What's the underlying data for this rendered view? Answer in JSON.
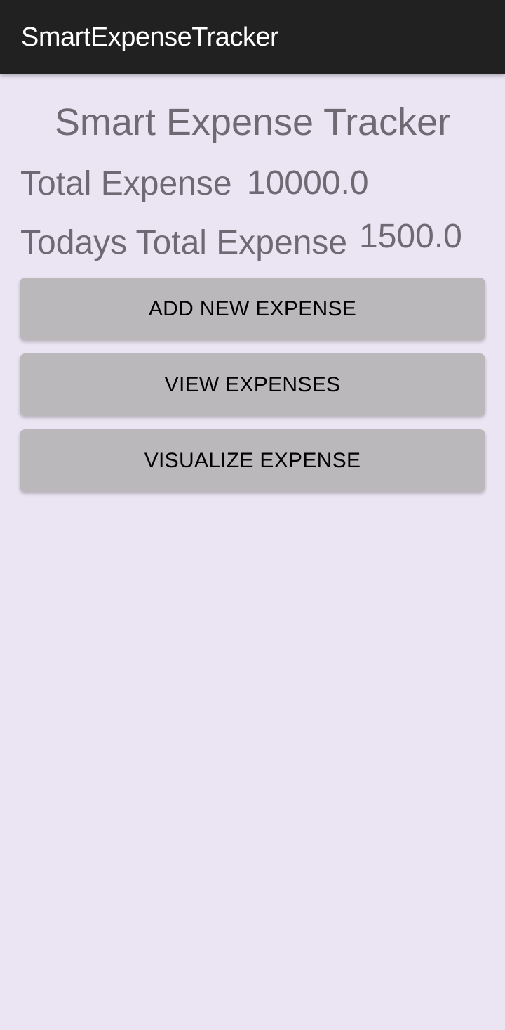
{
  "app_bar": {
    "title": "SmartExpenseTracker"
  },
  "main": {
    "heading": "Smart Expense Tracker",
    "total_expense": {
      "label": "Total Expense",
      "value": "10000.0"
    },
    "todays_total_expense": {
      "label": "Todays Total Expense",
      "value": "1500.0"
    },
    "buttons": {
      "add_new_expense": "ADD NEW EXPENSE",
      "view_expenses": "VIEW EXPENSES",
      "visualize_expense": "VISUALIZE EXPENSE"
    }
  },
  "colors": {
    "app_bar_bg": "#212121",
    "screen_bg": "#ebe5f3",
    "button_bg": "#bbb8bc",
    "text_gray": "#6e6a74"
  }
}
